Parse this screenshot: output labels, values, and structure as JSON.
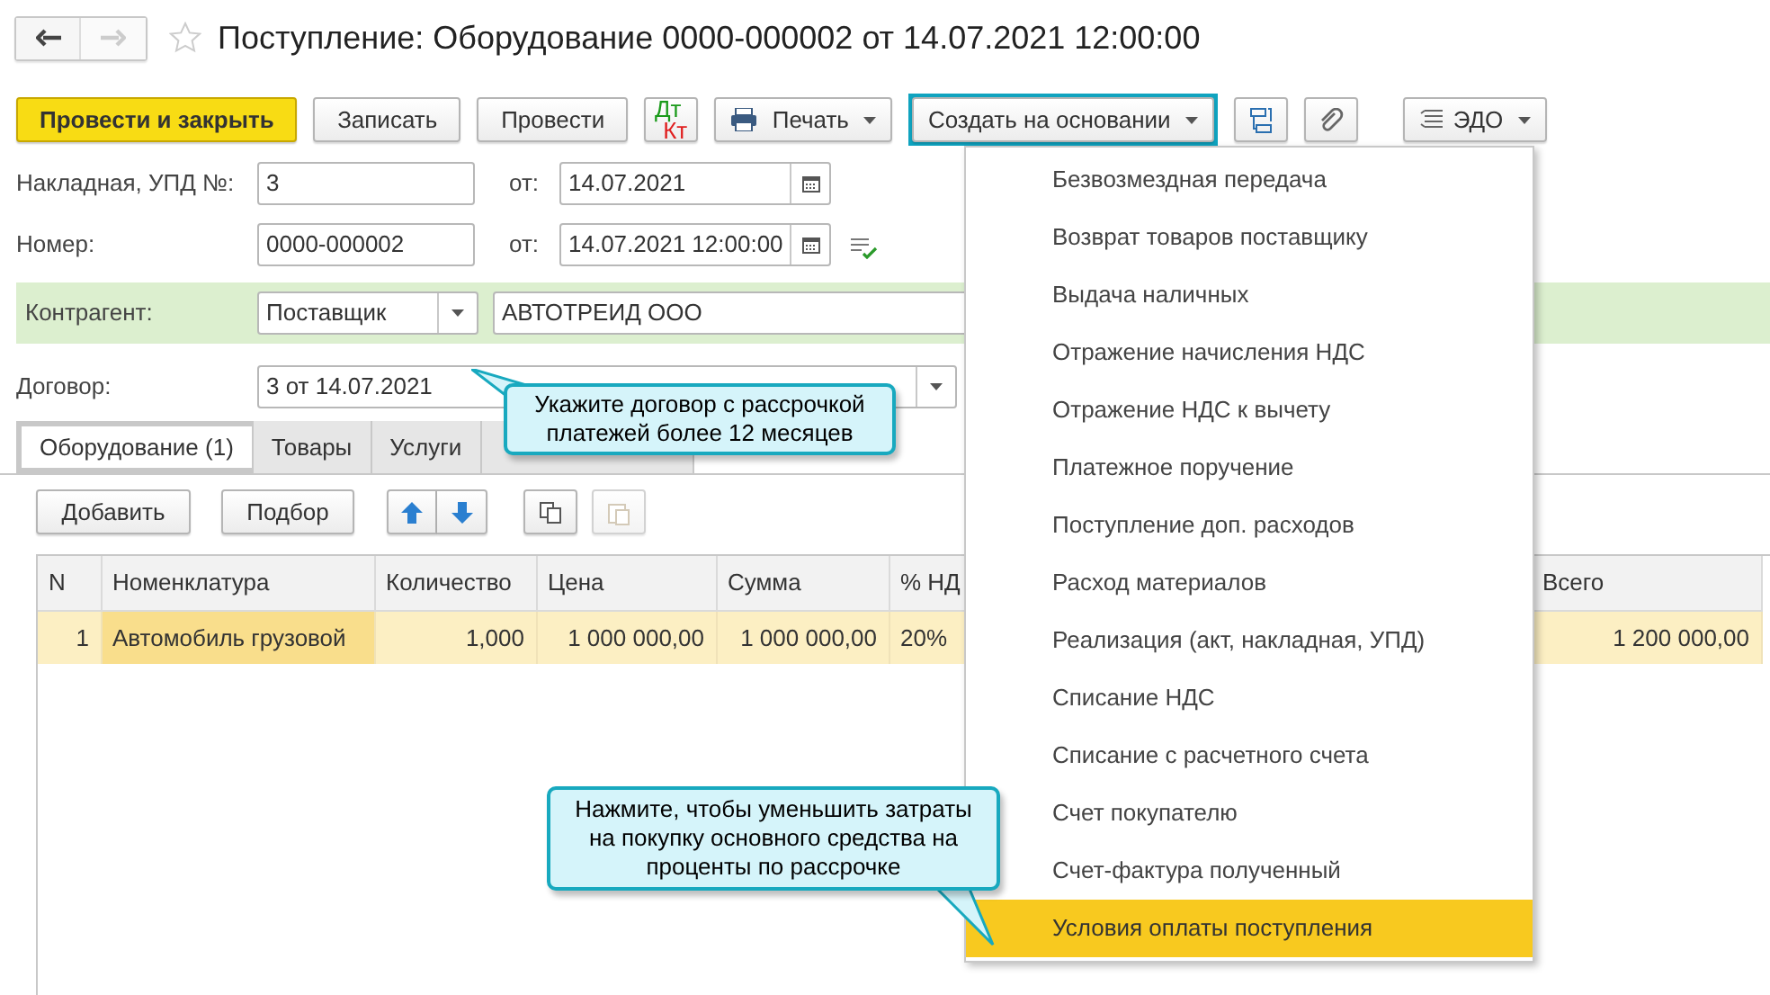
{
  "title": "Поступление: Оборудование 0000-000002 от 14.07.2021 12:00:00",
  "toolbar": [
    {
      "kind": "primary",
      "label": "Провести и закрыть"
    },
    {
      "kind": "plain",
      "label": "Записать"
    },
    {
      "kind": "plain",
      "label": "Провести"
    },
    {
      "kind": "dtkt",
      "label": "Дт",
      "label_2": "Кт"
    },
    {
      "kind": "print",
      "label": "Печать"
    },
    {
      "kind": "create",
      "label": "Создать на основании",
      "highlighted": true
    },
    {
      "kind": "structure"
    },
    {
      "kind": "attach"
    },
    {
      "kind": "edo",
      "label": "ЭДО"
    }
  ],
  "invoice": {
    "label": "Накладная, УПД №:",
    "value": "3",
    "date_label": "от:",
    "date": "14.07.2021"
  },
  "number": {
    "label": "Номер:",
    "value": "0000-000002",
    "date_label": "от:",
    "date": "14.07.2021 12:00:00"
  },
  "counterparty": {
    "label": "Контрагент:",
    "type": "Поставщик",
    "name": "АВТОТРЕИД ООО"
  },
  "contract": {
    "label": "Договор:",
    "value": "3 от 14.07.2021"
  },
  "tabs": [
    {
      "label": "Оборудование (1)",
      "selected": true,
      "highlighted": true
    },
    {
      "label": "Товары",
      "selected": false,
      "highlighted": false
    },
    {
      "label": "Услуги",
      "selected": false,
      "highlighted": false
    },
    {
      "selected": false,
      "highlighted": false
    }
  ],
  "table_toolbar": {
    "add": "Добавить",
    "pick": "Подбор"
  },
  "table": {
    "columns": [
      "N",
      "Номенклатура",
      "Количество",
      "Цена",
      "Сумма",
      "% НД",
      "",
      "Всего"
    ],
    "rows": [
      {
        "selected": true,
        "cells": [
          "1",
          "Автомобиль грузовой",
          "1,000",
          "1 000 000,00",
          "1 000 000,00",
          "20%",
          "",
          "1 200 000,00"
        ]
      }
    ]
  },
  "menu": [
    {
      "label": "Безвозмездная передача",
      "selected": false
    },
    {
      "label": "Возврат товаров поставщику",
      "selected": false
    },
    {
      "label": "Выдача наличных",
      "selected": false
    },
    {
      "label": "Отражение начисления НДС",
      "selected": false
    },
    {
      "label": "Отражение НДС к вычету",
      "selected": false
    },
    {
      "label": "Платежное поручение",
      "selected": false
    },
    {
      "label": "Поступление доп. расходов",
      "selected": false
    },
    {
      "label": "Расход материалов",
      "selected": false
    },
    {
      "label": "Реализация (акт, накладная, УПД)",
      "selected": false
    },
    {
      "label": "Списание НДС",
      "selected": false
    },
    {
      "label": "Списание с расчетного счета",
      "selected": false
    },
    {
      "label": "Счет покупателю",
      "selected": false
    },
    {
      "label": "Счет-фактура полученный",
      "selected": false
    },
    {
      "label": "Условия оплаты поступления",
      "selected": true
    }
  ],
  "callouts": [
    {
      "kind": "tail-left",
      "text": "Укажите договор с рассрочкой платежей более 12 месяцев"
    },
    {
      "kind": "tail-right",
      "text": "Нажмите, чтобы уменьшить затраты на покупку основного средства на проценты по рассрочке"
    }
  ]
}
